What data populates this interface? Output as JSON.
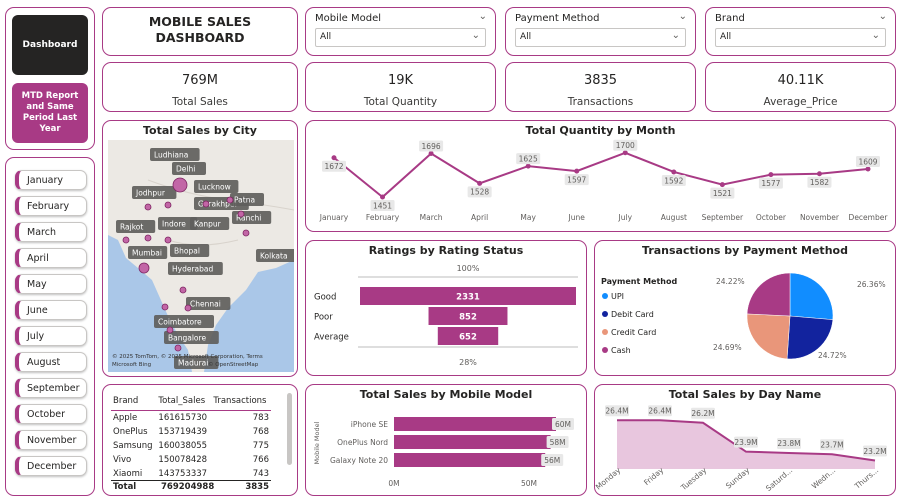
{
  "nav": {
    "dashboard": "Dashboard",
    "mtd": "MTD Report and Same Period Last Year"
  },
  "header": {
    "title": "MOBILE SALES DASHBOARD"
  },
  "slicers": [
    {
      "label": "Mobile Model",
      "value": "All"
    },
    {
      "label": "Payment Method",
      "value": "All"
    },
    {
      "label": "Brand",
      "value": "All"
    }
  ],
  "kpis": [
    {
      "value": "769M",
      "label": "Total Sales"
    },
    {
      "value": "19K",
      "label": "Total Quantity"
    },
    {
      "value": "3835",
      "label": "Transactions"
    },
    {
      "value": "40.11K",
      "label": "Average_Price"
    }
  ],
  "months": [
    "January",
    "February",
    "March",
    "April",
    "May",
    "June",
    "July",
    "August",
    "September",
    "October",
    "November",
    "December"
  ],
  "map": {
    "title": "Total Sales by City",
    "cities": [
      "Ludhiana",
      "Delhi",
      "Lucknow",
      "Jodhpur",
      "Gorakhpur",
      "Patna",
      "Ranchi",
      "Rajkot",
      "Indore",
      "Kanpur",
      "Mumbai",
      "Bhopal",
      "Kolkata",
      "Hyderabad",
      "Chennai",
      "Coimbatore",
      "Bangalore",
      "Madurai"
    ],
    "attribution": "© 2025 TomTom, © 2025 Microsoft Corporation, Terms",
    "bing": "Microsoft Bing",
    "osm": "© OpenStreetMap"
  },
  "qty_chart": {
    "title": "Total Quantity by Month",
    "months": [
      "January",
      "February",
      "March",
      "April",
      "May",
      "June",
      "July",
      "August",
      "September",
      "October",
      "November",
      "December"
    ],
    "values": [
      1672,
      1451,
      1696,
      1528,
      1625,
      1597,
      1700,
      1592,
      1521,
      1577,
      1582,
      1609
    ]
  },
  "ratings": {
    "title": "Ratings by Rating Status",
    "top_label": "100%",
    "bottom_label": "28%",
    "categories": [
      "Good",
      "Poor",
      "Average"
    ],
    "values": [
      2331,
      852,
      652
    ]
  },
  "payment_pie": {
    "title": "Transactions by Payment Method",
    "legend_title": "Payment Method",
    "labels": [
      "UPI",
      "Debit Card",
      "Credit Card",
      "Cash"
    ],
    "values": [
      26.36,
      24.72,
      24.69,
      24.22
    ],
    "value_labels": [
      "26.36%",
      "24.72%",
      "24.69%",
      "24.22%"
    ],
    "colors": [
      "#118dff",
      "#12239e",
      "#e9967a",
      "#a83a85"
    ]
  },
  "brand_table": {
    "headers": [
      "Brand",
      "Total_Sales",
      "Transactions"
    ],
    "rows": [
      [
        "Apple",
        "161615730",
        "783"
      ],
      [
        "OnePlus",
        "153719439",
        "768"
      ],
      [
        "Samsung",
        "160038055",
        "775"
      ],
      [
        "Vivo",
        "150078428",
        "766"
      ],
      [
        "Xiaomi",
        "143753337",
        "743"
      ]
    ],
    "total": [
      "Total",
      "769204988",
      "3835"
    ]
  },
  "model_chart": {
    "title": "Total Sales by Mobile Model",
    "ylabel": "Mobile Model",
    "categories": [
      "iPhone SE",
      "OnePlus Nord",
      "Galaxy Note 20"
    ],
    "values": [
      60,
      58,
      56
    ],
    "value_labels": [
      "60M",
      "58M",
      "56M"
    ],
    "ticks": [
      "0M",
      "50M"
    ]
  },
  "day_chart": {
    "title": "Total Sales by Day Name",
    "categories": [
      "Monday",
      "Friday",
      "Tuesday",
      "Sunday",
      "Saturd...",
      "Wedn...",
      "Thurs..."
    ],
    "values": [
      26.4,
      26.4,
      26.2,
      23.9,
      23.8,
      23.7,
      23.2
    ],
    "value_labels": [
      "26.4M",
      "26.4M",
      "26.2M",
      "23.9M",
      "23.8M",
      "23.7M",
      "23.2M"
    ]
  },
  "colors": {
    "accent": "#a83a85",
    "dark": "#252423"
  }
}
